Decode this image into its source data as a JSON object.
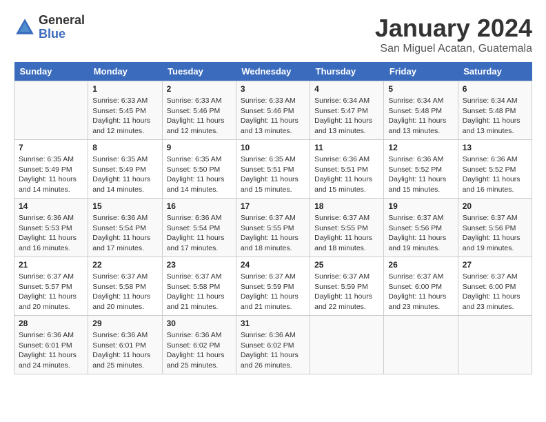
{
  "header": {
    "logo_line1": "General",
    "logo_line2": "Blue",
    "title": "January 2024",
    "subtitle": "San Miguel Acatan, Guatemala"
  },
  "weekdays": [
    "Sunday",
    "Monday",
    "Tuesday",
    "Wednesday",
    "Thursday",
    "Friday",
    "Saturday"
  ],
  "weeks": [
    [
      {
        "day": "",
        "sunrise": "",
        "sunset": "",
        "daylight": ""
      },
      {
        "day": "1",
        "sunrise": "Sunrise: 6:33 AM",
        "sunset": "Sunset: 5:45 PM",
        "daylight": "Daylight: 11 hours and 12 minutes."
      },
      {
        "day": "2",
        "sunrise": "Sunrise: 6:33 AM",
        "sunset": "Sunset: 5:46 PM",
        "daylight": "Daylight: 11 hours and 12 minutes."
      },
      {
        "day": "3",
        "sunrise": "Sunrise: 6:33 AM",
        "sunset": "Sunset: 5:46 PM",
        "daylight": "Daylight: 11 hours and 13 minutes."
      },
      {
        "day": "4",
        "sunrise": "Sunrise: 6:34 AM",
        "sunset": "Sunset: 5:47 PM",
        "daylight": "Daylight: 11 hours and 13 minutes."
      },
      {
        "day": "5",
        "sunrise": "Sunrise: 6:34 AM",
        "sunset": "Sunset: 5:48 PM",
        "daylight": "Daylight: 11 hours and 13 minutes."
      },
      {
        "day": "6",
        "sunrise": "Sunrise: 6:34 AM",
        "sunset": "Sunset: 5:48 PM",
        "daylight": "Daylight: 11 hours and 13 minutes."
      }
    ],
    [
      {
        "day": "7",
        "sunrise": "Sunrise: 6:35 AM",
        "sunset": "Sunset: 5:49 PM",
        "daylight": "Daylight: 11 hours and 14 minutes."
      },
      {
        "day": "8",
        "sunrise": "Sunrise: 6:35 AM",
        "sunset": "Sunset: 5:49 PM",
        "daylight": "Daylight: 11 hours and 14 minutes."
      },
      {
        "day": "9",
        "sunrise": "Sunrise: 6:35 AM",
        "sunset": "Sunset: 5:50 PM",
        "daylight": "Daylight: 11 hours and 14 minutes."
      },
      {
        "day": "10",
        "sunrise": "Sunrise: 6:35 AM",
        "sunset": "Sunset: 5:51 PM",
        "daylight": "Daylight: 11 hours and 15 minutes."
      },
      {
        "day": "11",
        "sunrise": "Sunrise: 6:36 AM",
        "sunset": "Sunset: 5:51 PM",
        "daylight": "Daylight: 11 hours and 15 minutes."
      },
      {
        "day": "12",
        "sunrise": "Sunrise: 6:36 AM",
        "sunset": "Sunset: 5:52 PM",
        "daylight": "Daylight: 11 hours and 15 minutes."
      },
      {
        "day": "13",
        "sunrise": "Sunrise: 6:36 AM",
        "sunset": "Sunset: 5:52 PM",
        "daylight": "Daylight: 11 hours and 16 minutes."
      }
    ],
    [
      {
        "day": "14",
        "sunrise": "Sunrise: 6:36 AM",
        "sunset": "Sunset: 5:53 PM",
        "daylight": "Daylight: 11 hours and 16 minutes."
      },
      {
        "day": "15",
        "sunrise": "Sunrise: 6:36 AM",
        "sunset": "Sunset: 5:54 PM",
        "daylight": "Daylight: 11 hours and 17 minutes."
      },
      {
        "day": "16",
        "sunrise": "Sunrise: 6:36 AM",
        "sunset": "Sunset: 5:54 PM",
        "daylight": "Daylight: 11 hours and 17 minutes."
      },
      {
        "day": "17",
        "sunrise": "Sunrise: 6:37 AM",
        "sunset": "Sunset: 5:55 PM",
        "daylight": "Daylight: 11 hours and 18 minutes."
      },
      {
        "day": "18",
        "sunrise": "Sunrise: 6:37 AM",
        "sunset": "Sunset: 5:55 PM",
        "daylight": "Daylight: 11 hours and 18 minutes."
      },
      {
        "day": "19",
        "sunrise": "Sunrise: 6:37 AM",
        "sunset": "Sunset: 5:56 PM",
        "daylight": "Daylight: 11 hours and 19 minutes."
      },
      {
        "day": "20",
        "sunrise": "Sunrise: 6:37 AM",
        "sunset": "Sunset: 5:56 PM",
        "daylight": "Daylight: 11 hours and 19 minutes."
      }
    ],
    [
      {
        "day": "21",
        "sunrise": "Sunrise: 6:37 AM",
        "sunset": "Sunset: 5:57 PM",
        "daylight": "Daylight: 11 hours and 20 minutes."
      },
      {
        "day": "22",
        "sunrise": "Sunrise: 6:37 AM",
        "sunset": "Sunset: 5:58 PM",
        "daylight": "Daylight: 11 hours and 20 minutes."
      },
      {
        "day": "23",
        "sunrise": "Sunrise: 6:37 AM",
        "sunset": "Sunset: 5:58 PM",
        "daylight": "Daylight: 11 hours and 21 minutes."
      },
      {
        "day": "24",
        "sunrise": "Sunrise: 6:37 AM",
        "sunset": "Sunset: 5:59 PM",
        "daylight": "Daylight: 11 hours and 21 minutes."
      },
      {
        "day": "25",
        "sunrise": "Sunrise: 6:37 AM",
        "sunset": "Sunset: 5:59 PM",
        "daylight": "Daylight: 11 hours and 22 minutes."
      },
      {
        "day": "26",
        "sunrise": "Sunrise: 6:37 AM",
        "sunset": "Sunset: 6:00 PM",
        "daylight": "Daylight: 11 hours and 23 minutes."
      },
      {
        "day": "27",
        "sunrise": "Sunrise: 6:37 AM",
        "sunset": "Sunset: 6:00 PM",
        "daylight": "Daylight: 11 hours and 23 minutes."
      }
    ],
    [
      {
        "day": "28",
        "sunrise": "Sunrise: 6:36 AM",
        "sunset": "Sunset: 6:01 PM",
        "daylight": "Daylight: 11 hours and 24 minutes."
      },
      {
        "day": "29",
        "sunrise": "Sunrise: 6:36 AM",
        "sunset": "Sunset: 6:01 PM",
        "daylight": "Daylight: 11 hours and 25 minutes."
      },
      {
        "day": "30",
        "sunrise": "Sunrise: 6:36 AM",
        "sunset": "Sunset: 6:02 PM",
        "daylight": "Daylight: 11 hours and 25 minutes."
      },
      {
        "day": "31",
        "sunrise": "Sunrise: 6:36 AM",
        "sunset": "Sunset: 6:02 PM",
        "daylight": "Daylight: 11 hours and 26 minutes."
      },
      {
        "day": "",
        "sunrise": "",
        "sunset": "",
        "daylight": ""
      },
      {
        "day": "",
        "sunrise": "",
        "sunset": "",
        "daylight": ""
      },
      {
        "day": "",
        "sunrise": "",
        "sunset": "",
        "daylight": ""
      }
    ]
  ]
}
